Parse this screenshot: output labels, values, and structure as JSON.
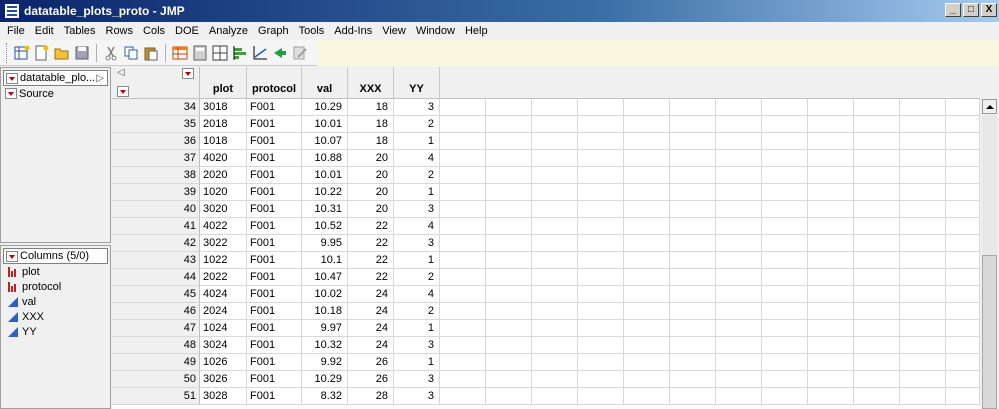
{
  "window": {
    "title": "datatable_plots_proto - JMP",
    "minimize": "_",
    "maximize": "□",
    "close": "X"
  },
  "menu": [
    "File",
    "Edit",
    "Tables",
    "Rows",
    "Cols",
    "DOE",
    "Analyze",
    "Graph",
    "Tools",
    "Add-Ins",
    "View",
    "Window",
    "Help"
  ],
  "toolbar": {
    "icons": [
      "new-table-icon",
      "new-data-icon",
      "open-icon",
      "save-icon",
      "cut-icon",
      "copy-icon",
      "paste-icon",
      "table-icon",
      "calculator-icon",
      "grid-icon",
      "distribution-icon",
      "fit-y-by-x-icon",
      "fit-model-icon",
      "edit-icon"
    ]
  },
  "tables_pane": {
    "table_name": "datatable_plo...",
    "items": [
      "Source"
    ]
  },
  "columns_pane": {
    "header": "Columns (5/0)",
    "columns": [
      {
        "name": "plot",
        "type": "nominal"
      },
      {
        "name": "protocol",
        "type": "nominal"
      },
      {
        "name": "val",
        "type": "continuous"
      },
      {
        "name": "XXX",
        "type": "continuous"
      },
      {
        "name": "YY",
        "type": "continuous"
      }
    ]
  },
  "grid": {
    "headers": [
      "plot",
      "protocol",
      "val",
      "XXX",
      "YY"
    ],
    "rows": [
      {
        "n": "34",
        "plot": "3018",
        "protocol": "F001",
        "val": "10.29",
        "XXX": "18",
        "YY": "3"
      },
      {
        "n": "35",
        "plot": "2018",
        "protocol": "F001",
        "val": "10.01",
        "XXX": "18",
        "YY": "2"
      },
      {
        "n": "36",
        "plot": "1018",
        "protocol": "F001",
        "val": "10.07",
        "XXX": "18",
        "YY": "1"
      },
      {
        "n": "37",
        "plot": "4020",
        "protocol": "F001",
        "val": "10.88",
        "XXX": "20",
        "YY": "4"
      },
      {
        "n": "38",
        "plot": "2020",
        "protocol": "F001",
        "val": "10.01",
        "XXX": "20",
        "YY": "2"
      },
      {
        "n": "39",
        "plot": "1020",
        "protocol": "F001",
        "val": "10.22",
        "XXX": "20",
        "YY": "1"
      },
      {
        "n": "40",
        "plot": "3020",
        "protocol": "F001",
        "val": "10.31",
        "XXX": "20",
        "YY": "3"
      },
      {
        "n": "41",
        "plot": "4022",
        "protocol": "F001",
        "val": "10.52",
        "XXX": "22",
        "YY": "4"
      },
      {
        "n": "42",
        "plot": "3022",
        "protocol": "F001",
        "val": "9.95",
        "XXX": "22",
        "YY": "3"
      },
      {
        "n": "43",
        "plot": "1022",
        "protocol": "F001",
        "val": "10.1",
        "XXX": "22",
        "YY": "1"
      },
      {
        "n": "44",
        "plot": "2022",
        "protocol": "F001",
        "val": "10.47",
        "XXX": "22",
        "YY": "2"
      },
      {
        "n": "45",
        "plot": "4024",
        "protocol": "F001",
        "val": "10.02",
        "XXX": "24",
        "YY": "4"
      },
      {
        "n": "46",
        "plot": "2024",
        "protocol": "F001",
        "val": "10.18",
        "XXX": "24",
        "YY": "2"
      },
      {
        "n": "47",
        "plot": "1024",
        "protocol": "F001",
        "val": "9.97",
        "XXX": "24",
        "YY": "1"
      },
      {
        "n": "48",
        "plot": "3024",
        "protocol": "F001",
        "val": "10.32",
        "XXX": "24",
        "YY": "3"
      },
      {
        "n": "49",
        "plot": "1026",
        "protocol": "F001",
        "val": "9.92",
        "XXX": "26",
        "YY": "1"
      },
      {
        "n": "50",
        "plot": "3026",
        "protocol": "F001",
        "val": "10.29",
        "XXX": "26",
        "YY": "3"
      },
      {
        "n": "51",
        "plot": "3028",
        "protocol": "F001",
        "val": "8.32",
        "XXX": "28",
        "YY": "3"
      }
    ]
  },
  "colors": {
    "title_start": "#0a246a",
    "title_end": "#a6caf0",
    "accent_red": "#c00000",
    "continuous_blue": "#3060c0"
  }
}
